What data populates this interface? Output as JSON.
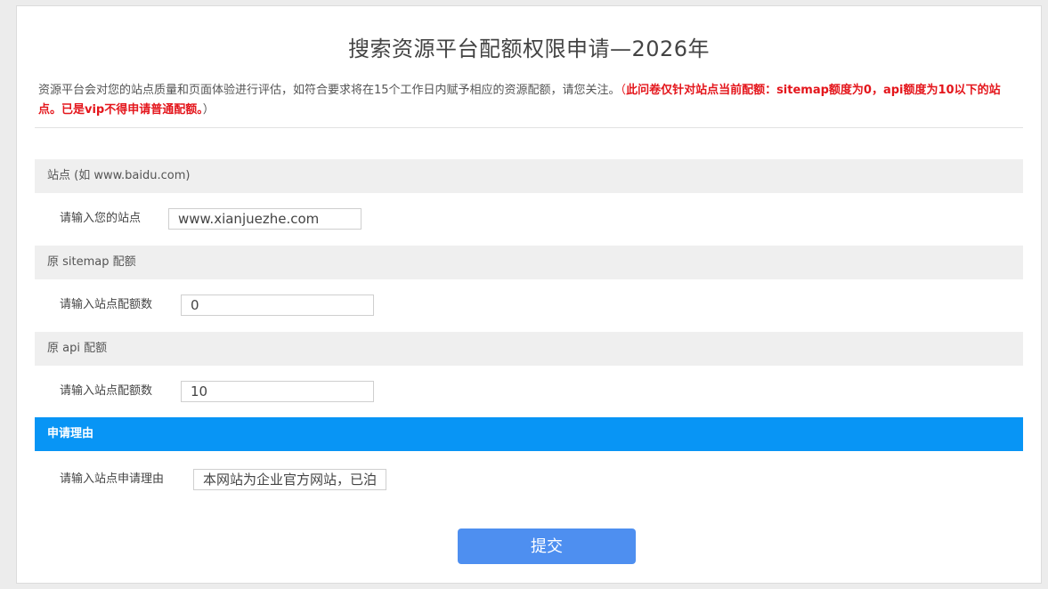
{
  "page": {
    "title": "搜索资源平台配额权限申请—2026年",
    "intro": "资源平台会对您的站点质量和页面体验进行评估，如符合要求将在15个工作日内赋予相应的资源配额，请您关注。",
    "intro_warning_open": "（",
    "intro_warning": "此问卷仅针对站点当前配额：sitemap额度为0，api额度为10以下的站点。已是vip不得申请普通配额。",
    "intro_warning_close": "）"
  },
  "sections": {
    "site": {
      "heading": "站点 (如 www.baidu.com)",
      "label": "请输入您的站点",
      "value": "www.xianjuezhe.com"
    },
    "sitemap": {
      "heading": "原 sitemap 配额",
      "label": "请输入站点配额数",
      "value": "0"
    },
    "api": {
      "heading": "原 api 配额",
      "label": "请输入站点配额数",
      "value": "10"
    },
    "reason": {
      "heading": "申请理由",
      "label": "请输入站点申请理由",
      "value": "本网站为企业官方网站，已泊"
    }
  },
  "actions": {
    "submit_label": "提交"
  },
  "colors": {
    "accent": "#0895f5",
    "button": "#4e8ff0",
    "warning": "#e4161c"
  }
}
